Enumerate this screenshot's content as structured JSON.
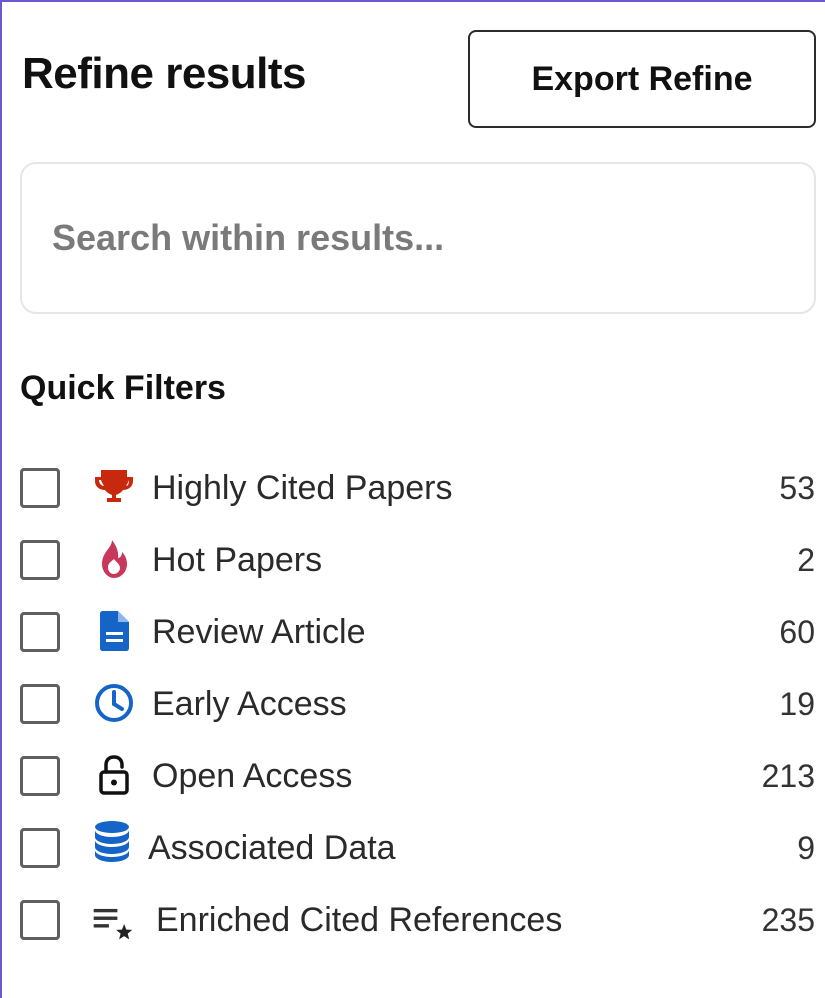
{
  "header": {
    "title": "Refine results",
    "export_label": "Export Refine"
  },
  "search": {
    "placeholder": "Search within results...",
    "value": ""
  },
  "quick_filters": {
    "title": "Quick Filters",
    "items": [
      {
        "label": "Highly Cited Papers",
        "count": "53",
        "icon": "trophy-icon",
        "checked": false,
        "color": "#c8290e"
      },
      {
        "label": "Hot Papers",
        "count": "2",
        "icon": "flame-icon",
        "checked": false,
        "color": "#c8385a"
      },
      {
        "label": "Review Article",
        "count": "60",
        "icon": "document-icon",
        "checked": false,
        "color": "#1565c8"
      },
      {
        "label": "Early Access",
        "count": "19",
        "icon": "clock-icon",
        "checked": false,
        "color": "#1565c8"
      },
      {
        "label": "Open Access",
        "count": "213",
        "icon": "unlock-icon",
        "checked": false,
        "color": "#111111"
      },
      {
        "label": "Associated Data",
        "count": "9",
        "icon": "database-icon",
        "checked": false,
        "color": "#1565c8"
      },
      {
        "label": "Enriched Cited References",
        "count": "235",
        "icon": "list-star-icon",
        "checked": false,
        "color": "#333333"
      }
    ]
  },
  "colors": {
    "frame_border": "#6a5acd",
    "checkbox_border": "#5f5f5f"
  }
}
